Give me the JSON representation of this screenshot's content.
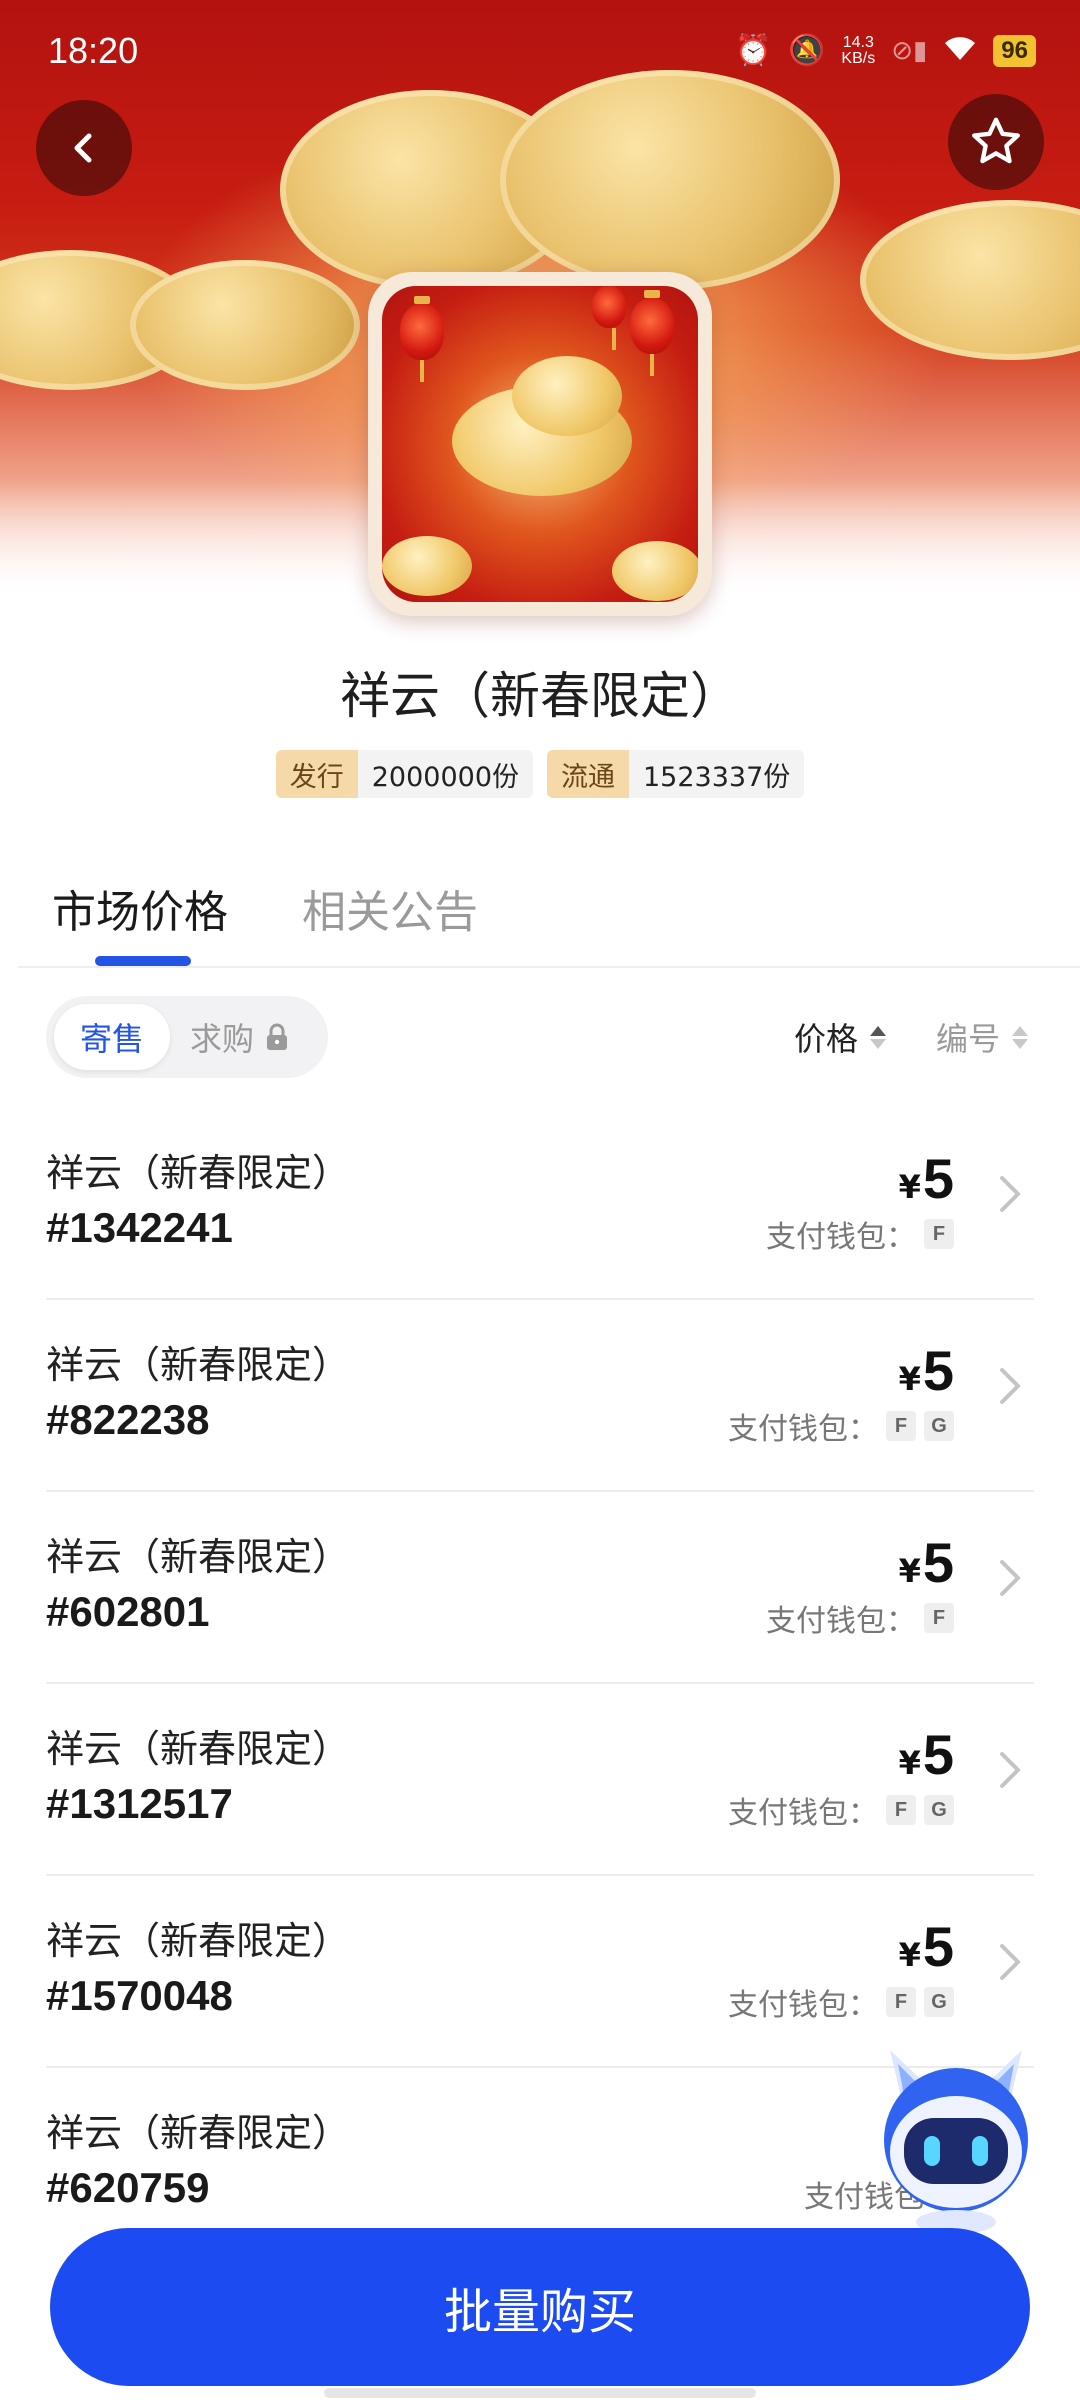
{
  "status_bar": {
    "time": "18:20",
    "net_speed_value": "14.3",
    "net_speed_unit": "KB/s",
    "battery": "96"
  },
  "header": {
    "back_icon": "chevron-left-icon",
    "favorite_icon": "star-outline-icon"
  },
  "product": {
    "title": "祥云（新春限定）",
    "stats": [
      {
        "label": "发行",
        "value": "2000000份"
      },
      {
        "label": "流通",
        "value": "1523337份"
      }
    ]
  },
  "tabs": [
    {
      "label": "市场价格",
      "active": true
    },
    {
      "label": "相关公告",
      "active": false
    }
  ],
  "filters": {
    "segments": [
      {
        "label": "寄售",
        "active": true
      },
      {
        "label": "求购",
        "active": false,
        "locked": true
      }
    ],
    "sort": [
      {
        "label": "价格",
        "active": true
      },
      {
        "label": "编号",
        "active": false
      }
    ]
  },
  "listings": [
    {
      "name": "祥云（新春限定）",
      "id": "#1342241",
      "currency": "¥",
      "price": "5",
      "wallet_label": "支付钱包：",
      "wallets": [
        "F"
      ]
    },
    {
      "name": "祥云（新春限定）",
      "id": "#822238",
      "currency": "¥",
      "price": "5",
      "wallet_label": "支付钱包：",
      "wallets": [
        "F",
        "G"
      ]
    },
    {
      "name": "祥云（新春限定）",
      "id": "#602801",
      "currency": "¥",
      "price": "5",
      "wallet_label": "支付钱包：",
      "wallets": [
        "F"
      ]
    },
    {
      "name": "祥云（新春限定）",
      "id": "#1312517",
      "currency": "¥",
      "price": "5",
      "wallet_label": "支付钱包：",
      "wallets": [
        "F",
        "G"
      ]
    },
    {
      "name": "祥云（新春限定）",
      "id": "#1570048",
      "currency": "¥",
      "price": "5",
      "wallet_label": "支付钱包：",
      "wallets": [
        "F",
        "G"
      ]
    },
    {
      "name": "祥云（新春限定）",
      "id": "#620759",
      "currency": "",
      "price": "",
      "wallet_label": "支付钱包：",
      "wallets": []
    }
  ],
  "bulk_buy": {
    "label": "批量购买"
  },
  "colors": {
    "accent": "#1d4bf2",
    "tab_indicator": "#2454e6",
    "hero_red": "#c71d12",
    "gold": "#e8c06a"
  }
}
